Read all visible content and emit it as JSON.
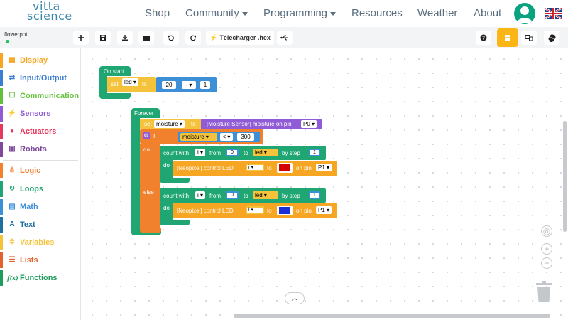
{
  "brand": {
    "line1": "vitta",
    "line2": "science"
  },
  "nav": {
    "shop": "Shop",
    "community": "Community",
    "programming": "Programming",
    "resources": "Resources",
    "weather": "Weather",
    "about": "About"
  },
  "project": {
    "name": "flowerpot"
  },
  "toolbar": {
    "download_label": "Télécharger .hex"
  },
  "sidebar": {
    "items": [
      {
        "label": "Display",
        "color": "#f6a623",
        "icon": "▦"
      },
      {
        "label": "Input/Output",
        "color": "#3a7fd1",
        "icon": "⇄"
      },
      {
        "label": "Communication",
        "color": "#62c13a",
        "icon": "☐"
      },
      {
        "label": "Sensors",
        "color": "#8f5bd6",
        "icon": "⚡"
      },
      {
        "label": "Actuators",
        "color": "#e7385f",
        "icon": "♦"
      },
      {
        "label": "Robots",
        "color": "#7e4a99",
        "icon": "▣"
      },
      {
        "label": "Logic",
        "color": "#f1812d",
        "icon": "⋔"
      },
      {
        "label": "Loops",
        "color": "#1fa672",
        "icon": "↻"
      },
      {
        "label": "Math",
        "color": "#3d8fd8",
        "icon": "▤"
      },
      {
        "label": "Text",
        "color": "#1f6fa0",
        "icon": "A"
      },
      {
        "label": "Variables",
        "color": "#f4c33b",
        "icon": "✲"
      },
      {
        "label": "Lists",
        "color": "#e2622f",
        "icon": "☰"
      },
      {
        "label": "Functions",
        "color": "#1e9d5c",
        "icon": "f(x)"
      }
    ]
  },
  "blocks": {
    "on_start": "On start",
    "set": "set",
    "led": "led",
    "to": "to",
    "twenty": "20",
    "minus": "-",
    "one": "1",
    "forever": "Forever",
    "moisture": "moisture",
    "sensor": "[Moisture Sensor] moisture on pin",
    "p0": "P0",
    "if": "if",
    "lt": "<",
    "threshold": "300",
    "do": "do",
    "else": "else",
    "count_with": "count with",
    "i": "i",
    "from": "from",
    "zero": "0",
    "by_step": "by step",
    "neopixel": "[Neopixel] control LED",
    "on_pin": "on pin",
    "p1": "P1"
  },
  "colors": {
    "accent": "#fbb515",
    "loops": "#1fa672",
    "logic": "#f1812d",
    "variables": "#f4c33b",
    "math": "#3d8fd8",
    "sensors": "#8f5bd6",
    "neopixel": "#f6a623",
    "led_red": "#d40000",
    "led_blue": "#1a2fd8"
  }
}
